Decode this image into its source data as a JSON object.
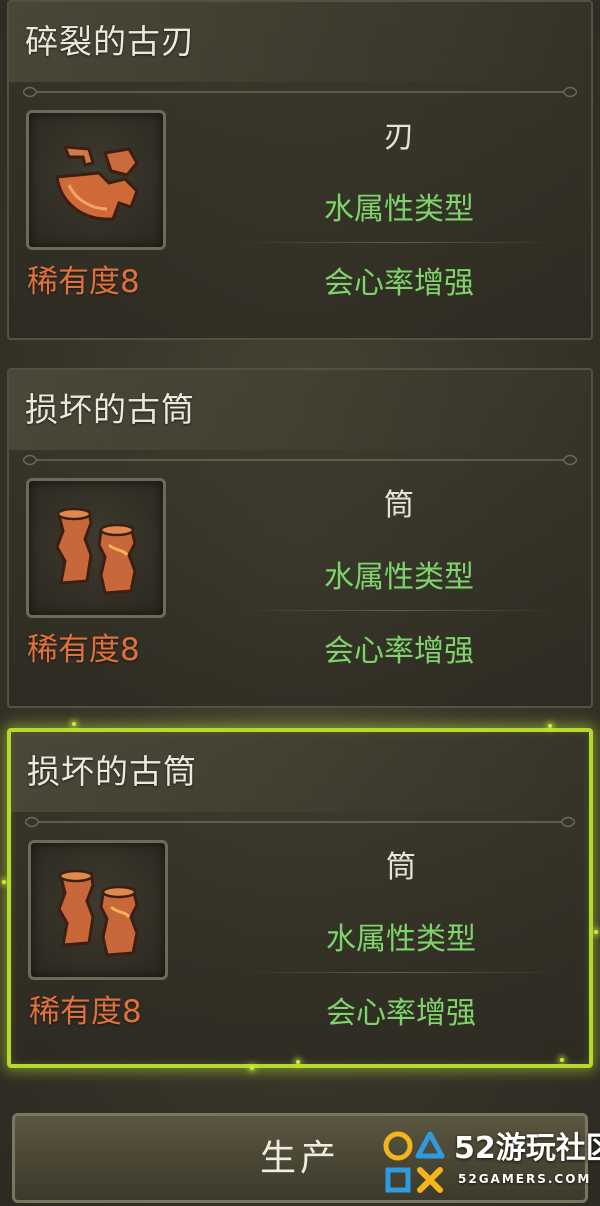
{
  "items": [
    {
      "name": "碎裂的古刃",
      "rarity": "稀有度8",
      "type": "刃",
      "element": "水属性类型",
      "skill": "会心率增强",
      "icon": "broken-blade-icon",
      "selected": false
    },
    {
      "name": "损坏的古筒",
      "rarity": "稀有度8",
      "type": "筒",
      "element": "水属性类型",
      "skill": "会心率增强",
      "icon": "broken-cylinder-icon",
      "selected": false
    },
    {
      "name": "损坏的古筒",
      "rarity": "稀有度8",
      "type": "筒",
      "element": "水属性类型",
      "skill": "会心率增强",
      "icon": "broken-cylinder-icon",
      "selected": true
    }
  ],
  "produce_button": {
    "label": "生产"
  },
  "watermark": {
    "brand": "52游玩社区",
    "sub": "52GAMERS.COM"
  },
  "colors": {
    "rarity": "#e0713f",
    "attribute_green": "#7ed46a",
    "selected_border": "#b6d92e",
    "icon_copper": "#c96a3c"
  }
}
